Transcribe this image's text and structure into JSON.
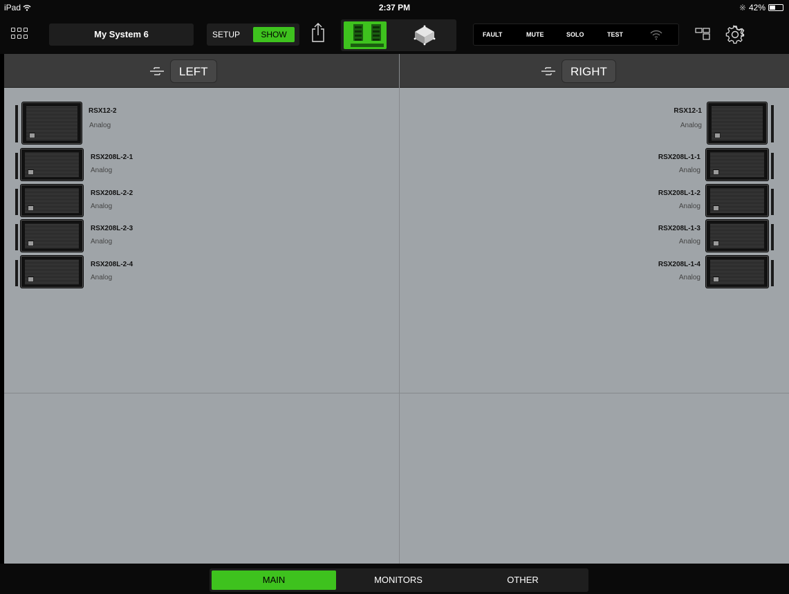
{
  "statusbar": {
    "device": "iPad",
    "time": "2:37 PM",
    "battery_text": "42%",
    "battery_level": 0.42
  },
  "toolbar": {
    "system_name": "My System 6",
    "mode_setup": "SETUP",
    "mode_show": "SHOW",
    "status_buttons": {
      "fault": "FAULT",
      "mute": "MUTE",
      "solo": "SOLO",
      "test": "TEST"
    }
  },
  "groups": {
    "left": {
      "label": "LEFT",
      "speakers": [
        {
          "name": "RSX12-2",
          "source": "Analog"
        },
        {
          "name": "RSX208L-2-1",
          "source": "Analog"
        },
        {
          "name": "RSX208L-2-2",
          "source": "Analog"
        },
        {
          "name": "RSX208L-2-3",
          "source": "Analog"
        },
        {
          "name": "RSX208L-2-4",
          "source": "Analog"
        }
      ]
    },
    "right": {
      "label": "RIGHT",
      "speakers": [
        {
          "name": "RSX12-1",
          "source": "Analog"
        },
        {
          "name": "RSX208L-1-1",
          "source": "Analog"
        },
        {
          "name": "RSX208L-1-2",
          "source": "Analog"
        },
        {
          "name": "RSX208L-1-3",
          "source": "Analog"
        },
        {
          "name": "RSX208L-1-4",
          "source": "Analog"
        }
      ]
    }
  },
  "tabs": {
    "main": "MAIN",
    "monitors": "MONITORS",
    "other": "OTHER"
  },
  "colors": {
    "accent": "#3ec21e",
    "panel": "#9fa4a8",
    "header": "#3b3b3b"
  }
}
